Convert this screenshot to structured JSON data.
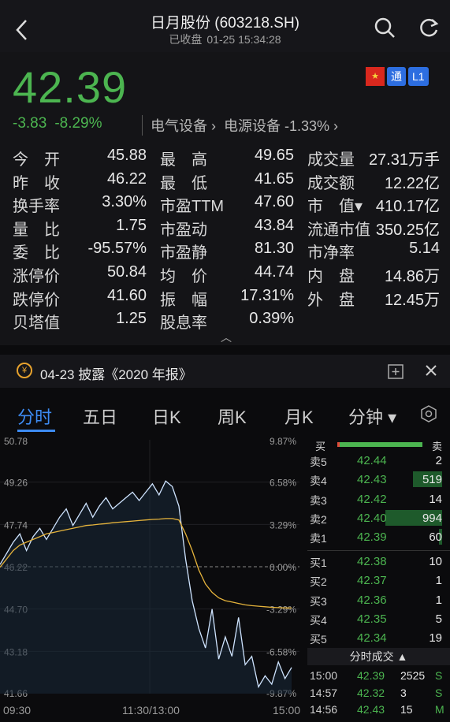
{
  "header": {
    "title": "日月股份 (603218.SH)",
    "status": "已收盘",
    "datetime": "01-25 15:34:28"
  },
  "quote": {
    "price": "42.39",
    "change": "-3.83",
    "change_pct": "-8.29%",
    "sector1": "电气设备 ›",
    "sector2": "电源设备 -1.33% ›",
    "badges": [
      "通",
      "L1"
    ],
    "stats": [
      [
        {
          "l": "今　开",
          "v": "45.88"
        },
        {
          "l": "最　高",
          "v": "49.65"
        },
        {
          "l": "成交量",
          "v": "27.31万手"
        }
      ],
      [
        {
          "l": "昨　收",
          "v": "46.22"
        },
        {
          "l": "最　低",
          "v": "41.65"
        },
        {
          "l": "成交额",
          "v": "12.22亿"
        }
      ],
      [
        {
          "l": "换手率",
          "v": "3.30%"
        },
        {
          "l": "市盈TTM",
          "v": "47.60"
        },
        {
          "l": "市　值▾",
          "v": "410.17亿"
        }
      ],
      [
        {
          "l": "量　比",
          "v": "1.75"
        },
        {
          "l": "市盈动",
          "v": "43.84"
        },
        {
          "l": "流通市值",
          "v": "350.25亿"
        }
      ],
      [
        {
          "l": "委　比",
          "v": "-95.57%"
        },
        {
          "l": "市盈静",
          "v": "81.30"
        },
        {
          "l": "市净率",
          "v": "5.14"
        }
      ],
      [
        {
          "l": "涨停价",
          "v": "50.84"
        },
        {
          "l": "均　价",
          "v": "44.74"
        },
        {
          "l": "内　盘",
          "v": "14.86万"
        }
      ],
      [
        {
          "l": "跌停价",
          "v": "41.60"
        },
        {
          "l": "振　幅",
          "v": "17.31%"
        },
        {
          "l": "外　盘",
          "v": "12.45万"
        }
      ],
      [
        {
          "l": "贝塔值",
          "v": "1.25"
        },
        {
          "l": "股息率",
          "v": "0.39%"
        }
      ]
    ]
  },
  "notice": {
    "text": "04-23 披露《2020 年报》"
  },
  "tabs": [
    "分时",
    "五日",
    "日K",
    "周K",
    "月K",
    "分钟 ▾"
  ],
  "chart_data": {
    "type": "line",
    "y_left": [
      "50.78",
      "49.26",
      "47.74",
      "46.22",
      "44.70",
      "43.18",
      "41.66"
    ],
    "y_right": [
      "9.87%",
      "6.58%",
      "3.29%",
      "0.00%",
      "-3.29%",
      "-6.58%",
      "-9.87%"
    ],
    "x_labels": [
      "09:30",
      "11:30/13:00",
      "15:00"
    ],
    "prev_close": 46.22,
    "ylim": [
      41.66,
      50.78
    ],
    "series": [
      {
        "values": [
          46.3,
          46.7,
          47.1,
          47.4,
          46.8,
          47.3,
          47.6,
          47.2,
          47.6,
          48.0,
          48.3,
          47.7,
          48.1,
          48.5,
          48.0,
          48.4,
          48.7,
          48.3,
          48.5,
          48.7,
          48.9,
          48.6,
          48.9,
          49.2,
          48.8,
          49.3,
          49.1,
          48.4,
          46.5,
          45.0,
          44.0,
          43.3,
          44.7,
          42.9,
          43.7,
          43.0,
          44.4,
          42.7,
          43.0,
          41.9,
          42.3,
          42.0,
          42.8,
          42.2,
          42.6
        ]
      },
      {
        "values": [
          46.2,
          46.5,
          46.8,
          47.0,
          47.1,
          47.2,
          47.3,
          47.4,
          47.45,
          47.5,
          47.55,
          47.6,
          47.65,
          47.7,
          47.72,
          47.75,
          47.77,
          47.8,
          47.82,
          47.84,
          47.86,
          47.88,
          47.9,
          47.92,
          47.93,
          47.95,
          47.95,
          47.9,
          47.4,
          46.8,
          46.1,
          45.6,
          45.3,
          45.1,
          45.0,
          44.95,
          44.9,
          44.85,
          44.82,
          44.8,
          44.78,
          44.76,
          44.75,
          44.74,
          44.74
        ]
      }
    ]
  },
  "orderbook": {
    "buy_label": "买",
    "sell_label": "卖",
    "asks": [
      {
        "n": "卖5",
        "p": "42.44",
        "q": "2",
        "r": 0.002
      },
      {
        "n": "卖4",
        "p": "42.43",
        "q": "519",
        "r": 0.52
      },
      {
        "n": "卖3",
        "p": "42.42",
        "q": "14",
        "r": 0.014
      },
      {
        "n": "卖2",
        "p": "42.40",
        "q": "994",
        "r": 1.0
      },
      {
        "n": "卖1",
        "p": "42.39",
        "q": "60",
        "r": 0.06
      }
    ],
    "bids": [
      {
        "n": "买1",
        "p": "42.38",
        "q": "10"
      },
      {
        "n": "买2",
        "p": "42.37",
        "q": "1"
      },
      {
        "n": "买3",
        "p": "42.36",
        "q": "1"
      },
      {
        "n": "买4",
        "p": "42.35",
        "q": "5"
      },
      {
        "n": "买5",
        "p": "42.34",
        "q": "19"
      }
    ],
    "ticks_title": "分时成交 ▲",
    "ticks": [
      {
        "t": "15:00",
        "p": "42.39",
        "v": "2525",
        "s": "S"
      },
      {
        "t": "14:57",
        "p": "42.32",
        "v": "3",
        "s": "S"
      },
      {
        "t": "14:56",
        "p": "42.43",
        "v": "15",
        "s": "M"
      }
    ]
  },
  "colors": {
    "down": "#4cb550",
    "accent": "#3d8bf2",
    "avg": "#e6b43c"
  }
}
